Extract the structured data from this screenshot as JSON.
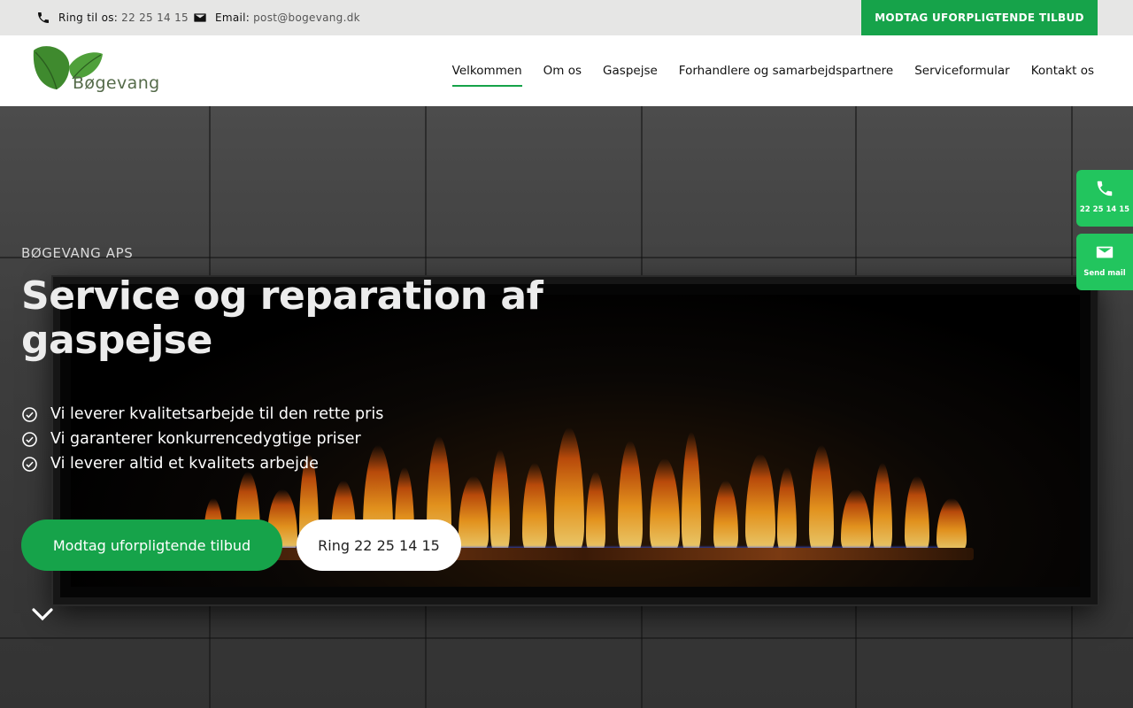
{
  "topbar": {
    "phone_label": "Ring til os:",
    "phone_number": "22 25 14 15",
    "email_label": "Email:",
    "email_address": "post@bogevang.dk",
    "cta": "MODTAG UFORPLIGTENDE TILBUD"
  },
  "header": {
    "brand": "Bøgevang",
    "nav": [
      {
        "label": "Velkommen",
        "active": true
      },
      {
        "label": "Om os"
      },
      {
        "label": "Gaspejse"
      },
      {
        "label": "Forhandlere og samarbejdspartnere"
      },
      {
        "label": "Serviceformular"
      },
      {
        "label": "Kontakt os"
      }
    ]
  },
  "hero": {
    "eyebrow": "BØGEVANG APS",
    "title": "Service og reparation af gaspejse",
    "bullets": [
      "Vi leverer kvalitetsarbejde til den rette pris",
      "Vi garanterer konkurrencedygtige priser",
      "Vi leverer altid et kvalitets arbejde"
    ],
    "primary_button": "Modtag uforpligtende tilbud",
    "secondary_button": "Ring 22 25 14 15"
  },
  "side_widgets": {
    "call_label": "22 25 14 15",
    "mail_label": "Send mail"
  },
  "colors": {
    "accent": "#16a34a",
    "widget": "#22c55e",
    "topbar_bg": "#e6e6e5"
  },
  "icons": [
    "phone-icon",
    "envelope-icon",
    "check-circle-icon",
    "chevron-down-icon",
    "leaf-logo"
  ]
}
